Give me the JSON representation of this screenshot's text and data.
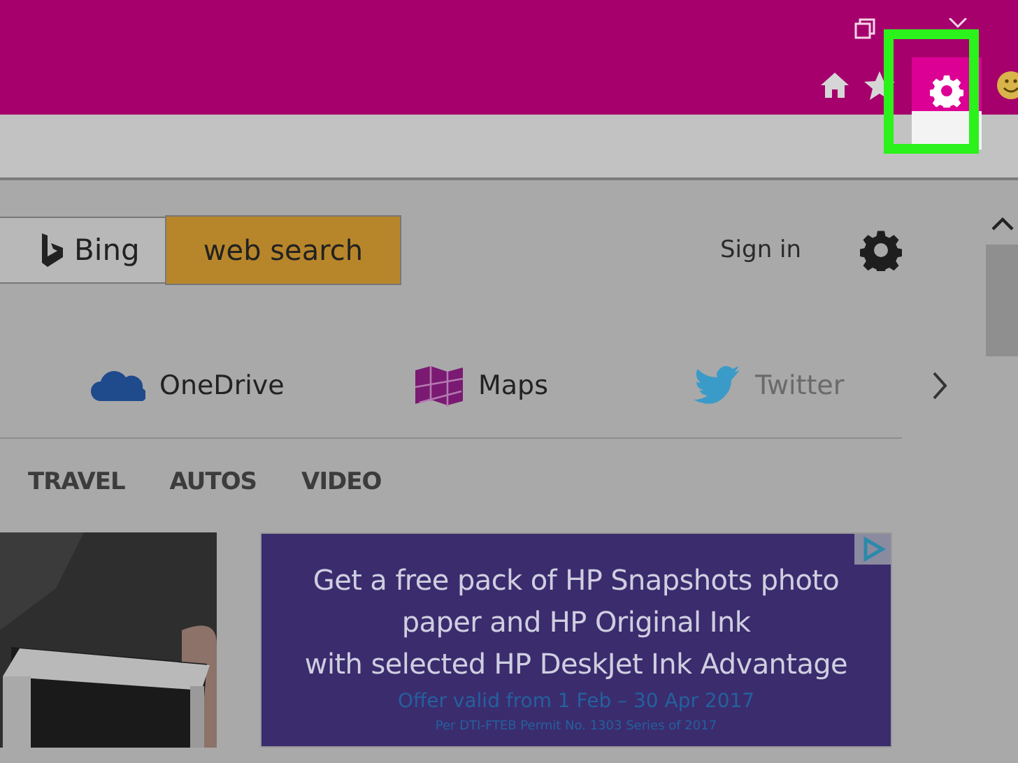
{
  "search": {
    "brand": "Bing",
    "button": "web search"
  },
  "header": {
    "sign_in": "Sign in"
  },
  "apps": [
    {
      "kind": "onedrive",
      "label": "OneDrive",
      "disabled": false
    },
    {
      "kind": "maps",
      "label": "Maps",
      "disabled": false
    },
    {
      "kind": "twitter",
      "label": "Twitter",
      "disabled": true
    }
  ],
  "nav": [
    "TRAVEL",
    "AUTOS",
    "VIDEO"
  ],
  "ad": {
    "lines": [
      "Get a free pack of HP Snapshots photo",
      "paper and HP Original Ink",
      "with selected HP DeskJet Ink Advantage"
    ],
    "offer": "Offer valid from 1 Feb – 30 Apr 2017",
    "permit": "Per DTI-FTEB Permit No. 1303 Series of 2017"
  }
}
